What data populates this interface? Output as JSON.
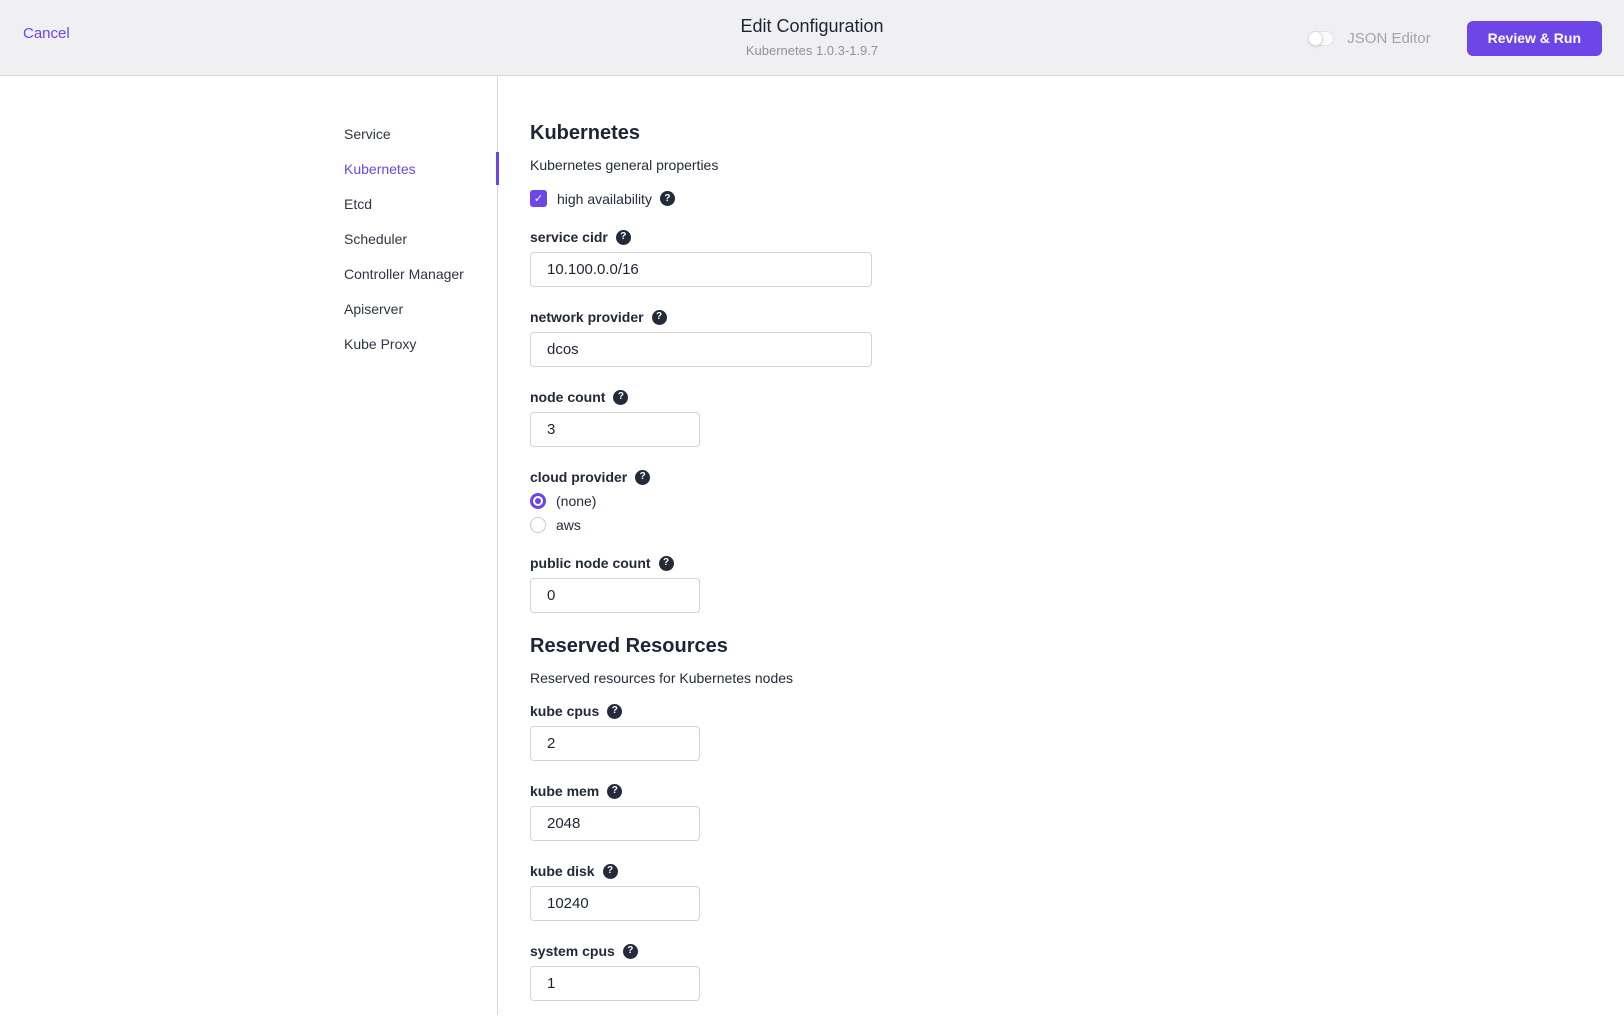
{
  "header": {
    "cancel": "Cancel",
    "title": "Edit Configuration",
    "subtitle": "Kubernetes 1.0.3-1.9.7",
    "json_editor_toggle": {
      "label": "JSON Editor",
      "state": "off"
    },
    "review_run": "Review & Run"
  },
  "sidebar": {
    "items": [
      {
        "label": "Service",
        "active": false
      },
      {
        "label": "Kubernetes",
        "active": true
      },
      {
        "label": "Etcd",
        "active": false
      },
      {
        "label": "Scheduler",
        "active": false
      },
      {
        "label": "Controller Manager",
        "active": false
      },
      {
        "label": "Apiserver",
        "active": false
      },
      {
        "label": "Kube Proxy",
        "active": false
      }
    ]
  },
  "form": {
    "section1": {
      "title": "Kubernetes",
      "description": "Kubernetes general properties"
    },
    "high_availability": {
      "label": "high availability",
      "checked": true
    },
    "fields": [
      {
        "label": "service cidr",
        "value": "10.100.0.0/16"
      },
      {
        "label": "network provider",
        "value": "dcos"
      },
      {
        "label": "node count",
        "value": "3"
      },
      {
        "label": "public node count",
        "value": "0"
      },
      {
        "label": "kube cpus",
        "value": "2"
      },
      {
        "label": "kube mem",
        "value": "2048"
      },
      {
        "label": "kube disk",
        "value": "10240"
      },
      {
        "label": "system cpus",
        "value": "1"
      }
    ],
    "cloud_provider": {
      "label": "cloud provider",
      "options": [
        {
          "label": "(none)",
          "selected": true
        },
        {
          "label": "aws",
          "selected": false
        }
      ]
    },
    "section2": {
      "title": "Reserved Resources",
      "description": "Reserved resources for Kubernetes nodes"
    }
  },
  "icons": {
    "help_glyph": "?",
    "check_glyph": "✓"
  },
  "colors": {
    "accent": "#6c46e6",
    "header_bg": "#f0f0f2",
    "help_icon_bg": "#232b39",
    "border": "#d9d9dc"
  }
}
